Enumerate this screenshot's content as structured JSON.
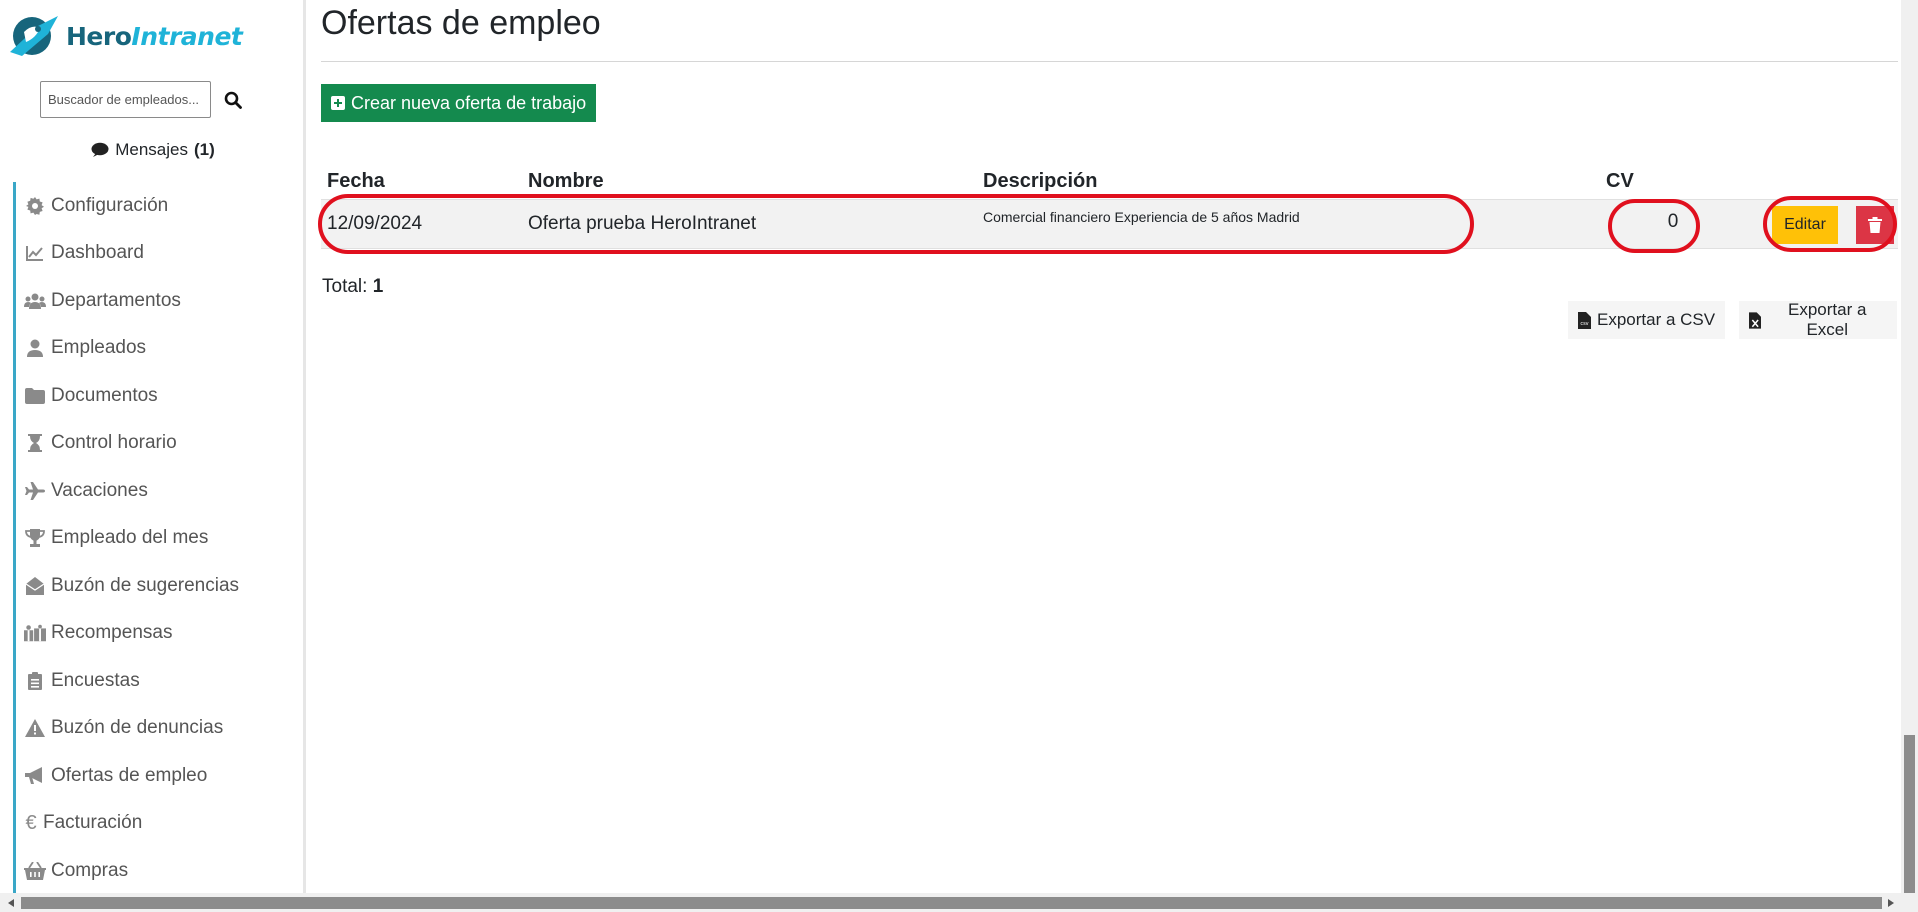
{
  "app": {
    "logo_hero": "Hero",
    "logo_intranet": "Intranet"
  },
  "sidebar": {
    "search_placeholder": "Buscador de empleados...",
    "messages_label": "Mensajes",
    "messages_count": "(1)",
    "items": [
      {
        "label": "Configuración",
        "icon": "gear-icon"
      },
      {
        "label": "Dashboard",
        "icon": "line-chart-icon"
      },
      {
        "label": "Departamentos",
        "icon": "users-icon"
      },
      {
        "label": "Empleados",
        "icon": "user-icon"
      },
      {
        "label": "Documentos",
        "icon": "folder-icon"
      },
      {
        "label": "Control horario",
        "icon": "hourglass-icon"
      },
      {
        "label": "Vacaciones",
        "icon": "plane-icon"
      },
      {
        "label": "Empleado del mes",
        "icon": "trophy-icon"
      },
      {
        "label": "Buzón de sugerencias",
        "icon": "envelope-open-icon"
      },
      {
        "label": "Recompensas",
        "icon": "gifts-icon"
      },
      {
        "label": "Encuestas",
        "icon": "clipboard-list-icon"
      },
      {
        "label": "Buzón de denuncias",
        "icon": "warning-icon"
      },
      {
        "label": "Ofertas de empleo",
        "icon": "bullhorn-icon"
      },
      {
        "label": "Facturación",
        "icon": "euro-icon"
      },
      {
        "label": "Compras",
        "icon": "basket-icon"
      }
    ]
  },
  "main": {
    "title": "Ofertas de empleo",
    "create_button": "Crear nueva oferta de trabajo",
    "columns": {
      "fecha": "Fecha",
      "nombre": "Nombre",
      "descripcion": "Descripción",
      "cv": "CV"
    },
    "rows": [
      {
        "fecha": "12/09/2024",
        "nombre": "Oferta prueba HeroIntranet",
        "descripcion": "Comercial financiero Experiencia de 5 años Madrid",
        "cv": "0",
        "edit_label": "Editar"
      }
    ],
    "total_label": "Total:",
    "total_value": "1",
    "export_csv": "Exportar a CSV",
    "export_excel": "Exportar a Excel"
  },
  "colors": {
    "accent": "#1fb3d8",
    "brand_dark": "#17657c",
    "create_button": "#148a4e",
    "edit_button": "#ffc107",
    "delete_button": "#dc3545",
    "annotation": "#e0101e"
  }
}
